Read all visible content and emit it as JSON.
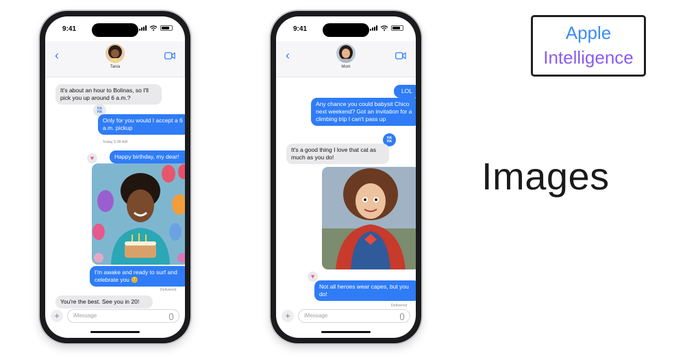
{
  "brand_box": {
    "line1": "Apple",
    "line2": "Intelligence"
  },
  "headline": "Images",
  "phones": [
    {
      "time": "9:41",
      "contact_name": "Tania",
      "messages": [
        {
          "text": "It's about an hour to Bolinas, so I'll pick you up around 6 a.m.?"
        },
        {
          "text": "Only for you would I accept a 6 a.m. pickup"
        },
        {
          "text": "Happy birthday, my dear!"
        },
        {
          "text": "I'm awake and ready to surf and celebrate you 😊"
        },
        {
          "text": "You're the best. See you in 20!"
        }
      ],
      "timestamp": "Today 5:38 AM",
      "delivered": "Delivered",
      "tapback_text": "HA HA",
      "input_placeholder": "iMessage"
    },
    {
      "time": "9:41",
      "contact_name": "Mom",
      "messages": [
        {
          "text": "LOL"
        },
        {
          "text": "Any chance you could babysit Chico next weekend? Got an invitation for a climbing trip I can't pass up"
        },
        {
          "text": "It's a good thing I love that cat as much as you do!"
        },
        {
          "text": "Not all heroes wear capes, but you do!"
        }
      ],
      "delivered": "Delivered",
      "tapback_text": "HA HA",
      "input_placeholder": "iMessage"
    }
  ],
  "colors": {
    "imessage_blue": "#2f7cf6",
    "incoming_gray": "#e9e9eb"
  }
}
